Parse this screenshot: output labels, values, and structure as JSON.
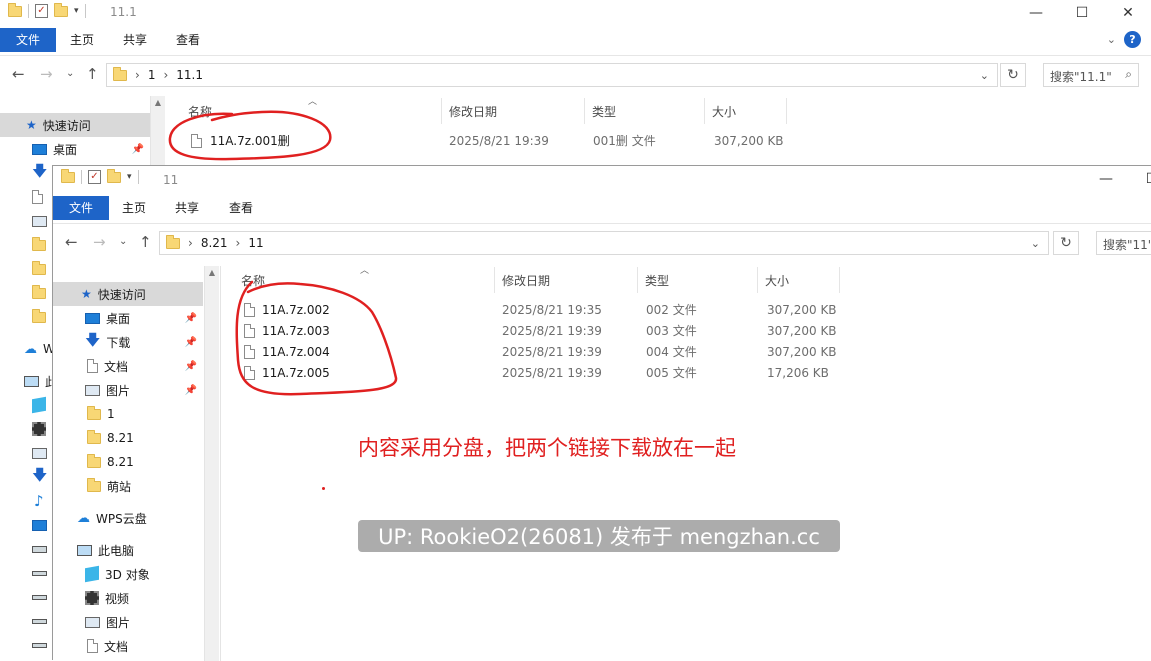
{
  "back_window": {
    "title": "11.1",
    "ribbon_tabs": [
      "文件",
      "主页",
      "共享",
      "查看"
    ],
    "breadcrumb": [
      "1",
      "11.1"
    ],
    "search_placeholder": "搜索\"11.1\"",
    "columns": [
      "名称",
      "修改日期",
      "类型",
      "大小"
    ],
    "quick_access": "快速访问",
    "nav_desktop": "桌面",
    "nav_w_partial": "W",
    "nav_this_pc_partial": "此",
    "files": [
      {
        "name": "11A.7z.001删",
        "date": "2025/8/21 19:39",
        "type": "001删 文件",
        "size": "307,200 KB"
      }
    ]
  },
  "front_window": {
    "title": "11",
    "ribbon_tabs": [
      "文件",
      "主页",
      "共享",
      "查看"
    ],
    "breadcrumb": [
      "8.21",
      "11"
    ],
    "search_placeholder": "搜索\"11\"",
    "columns": [
      "名称",
      "修改日期",
      "类型",
      "大小"
    ],
    "nav": {
      "quick_access": "快速访问",
      "items": [
        "桌面",
        "下载",
        "文档",
        "图片",
        "1",
        "8.21",
        "8.21",
        "萌站"
      ],
      "wps": "WPS云盘",
      "this_pc": "此电脑",
      "pc_items": [
        "3D 对象",
        "视频",
        "图片",
        "文档"
      ]
    },
    "files": [
      {
        "name": "11A.7z.002",
        "date": "2025/8/21 19:35",
        "type": "002 文件",
        "size": "307,200 KB"
      },
      {
        "name": "11A.7z.003",
        "date": "2025/8/21 19:39",
        "type": "003 文件",
        "size": "307,200 KB"
      },
      {
        "name": "11A.7z.004",
        "date": "2025/8/21 19:39",
        "type": "004 文件",
        "size": "307,200 KB"
      },
      {
        "name": "11A.7z.005",
        "date": "2025/8/21 19:39",
        "type": "005 文件",
        "size": "17,206 KB"
      }
    ]
  },
  "annotation_text": "内容采用分盘，把两个链接下载放在一起",
  "watermark": "UP: RookieO2(26081) 发布于 mengzhan.cc",
  "colors": {
    "accent": "#1e64c8",
    "annotation": "#e02020",
    "folder": "#f8d775"
  },
  "icons": [
    "folder-icon",
    "checklist-icon",
    "pin-icon",
    "document-icon",
    "download-arrow-icon",
    "cloud-icon",
    "pc-icon",
    "3d-object-icon",
    "video-icon",
    "picture-icon",
    "search-icon",
    "refresh-icon",
    "help-icon"
  ]
}
